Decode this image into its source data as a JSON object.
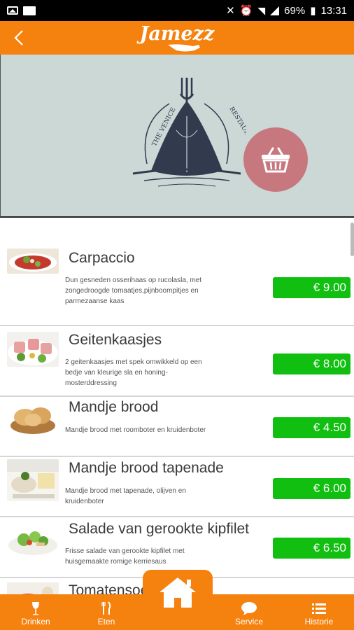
{
  "status_bar": {
    "battery": "69%",
    "time": "13:31",
    "icons": [
      "image-icon",
      "outlook-icon",
      "mute-icon",
      "alarm-icon",
      "wifi-icon",
      "signal-icon",
      "battery-icon"
    ]
  },
  "topbar": {
    "logo_text": "Jamezz",
    "back_icon": "chevron-left-icon"
  },
  "hero": {
    "restaurant_logo_text_left": "THE VENICE",
    "restaurant_logo_text_right": "RESTAURANT",
    "cart_icon": "basket-icon"
  },
  "menu_items": [
    {
      "title": "Carpaccio",
      "description": "Dun gesneden osserihaas op rucolasla, met zongedroogde tomaatjes,pijnboompitjes en parmezaanse kaas",
      "price": "€ 9.00"
    },
    {
      "title": "Geitenkaasjes",
      "description": "2 geitenkaasjes met spek omwikkeld op een bedje van kleurige sla en honing-mosterddressing",
      "price": "€ 8.00"
    },
    {
      "title": "Mandje brood",
      "description": "Mandje brood met roomboter en kruidenboter",
      "price": "€ 4.50"
    },
    {
      "title": "Mandje brood tapenade",
      "description": "Mandje brood met tapenade, olijven en kruidenboter",
      "price": "€ 6.00"
    },
    {
      "title": "Salade van gerookte kipfilet",
      "description": "Frisse salade van gerookte kipfilet met huisgemaakte romige kerriesaus",
      "price": "€ 6.50"
    },
    {
      "title": "Tomatensoep",
      "description": "",
      "price": ""
    }
  ],
  "bottom_nav": {
    "drinken": "Drinken",
    "eten": "Eten",
    "service": "Service",
    "historie": "Historie"
  },
  "colors": {
    "accent": "#f5820e",
    "price_green": "#10bf10",
    "cart_pink": "#c7787f",
    "hero_bg": "#ccd8d6"
  }
}
